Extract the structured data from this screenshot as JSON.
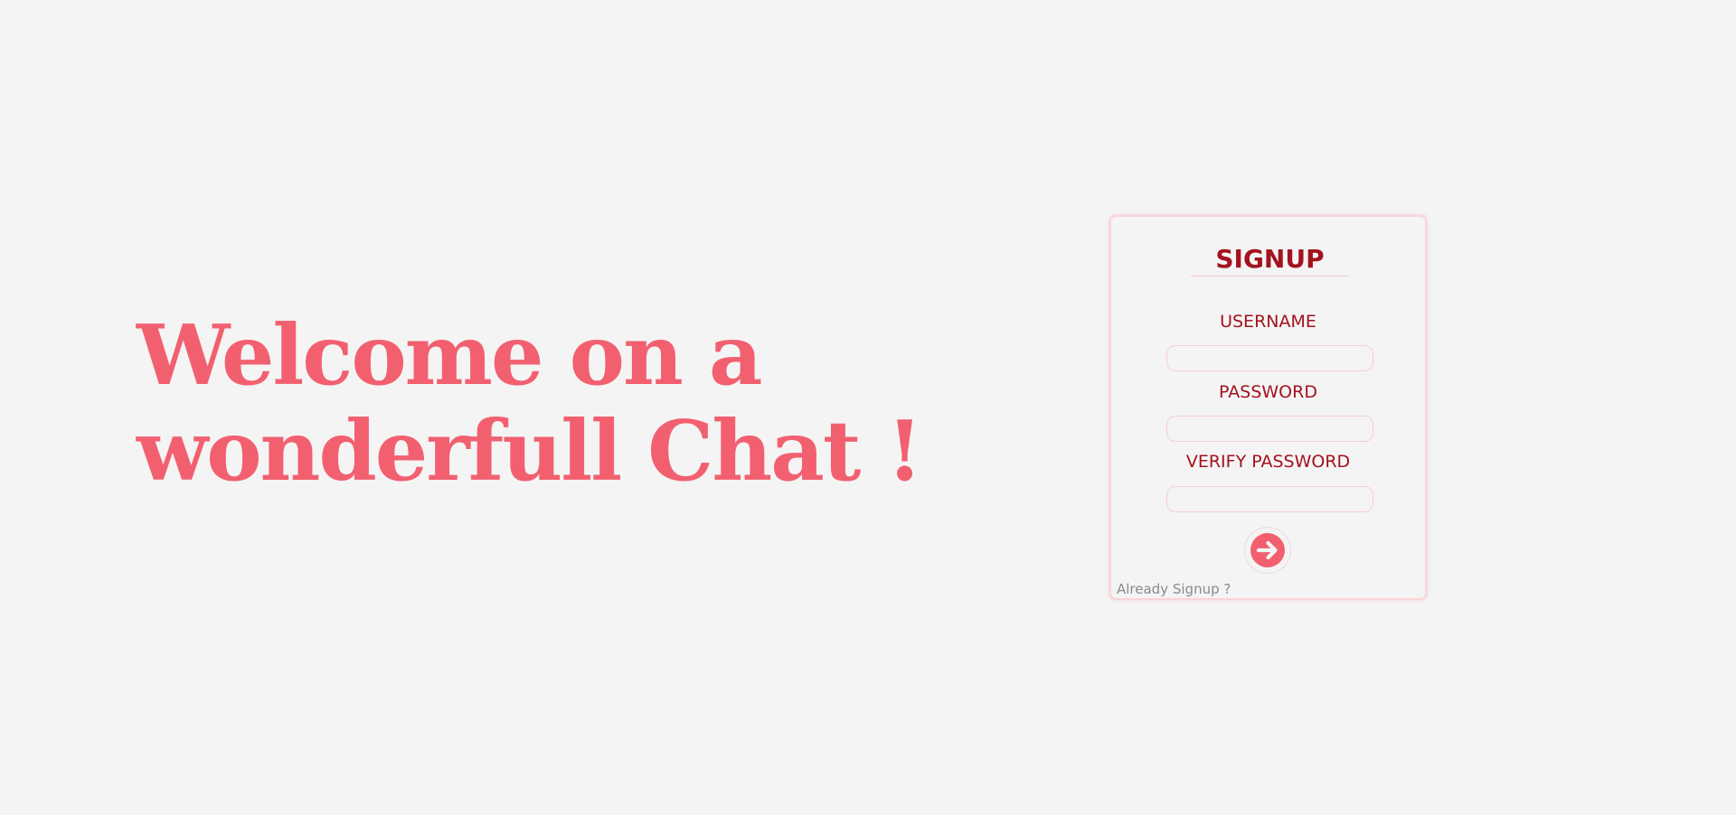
{
  "hero": {
    "line1": "Welcome on a",
    "line2": "wonderfull Chat !"
  },
  "signup": {
    "title": "SIGNUP",
    "fields": [
      {
        "label": "USERNAME",
        "value": "",
        "placeholder": ""
      },
      {
        "label": "PASSWORD",
        "value": "",
        "placeholder": ""
      },
      {
        "label": "VERIFY PASSWORD",
        "value": "",
        "placeholder": ""
      }
    ],
    "submit_icon": "arrow-right-circle-icon",
    "already_link": "Already Signup ?"
  },
  "colors": {
    "background": "#f4f4f4",
    "accent": "#f26070",
    "label": "#a3121f",
    "border": "#fbd3d8",
    "muted": "#8a8a8a"
  }
}
